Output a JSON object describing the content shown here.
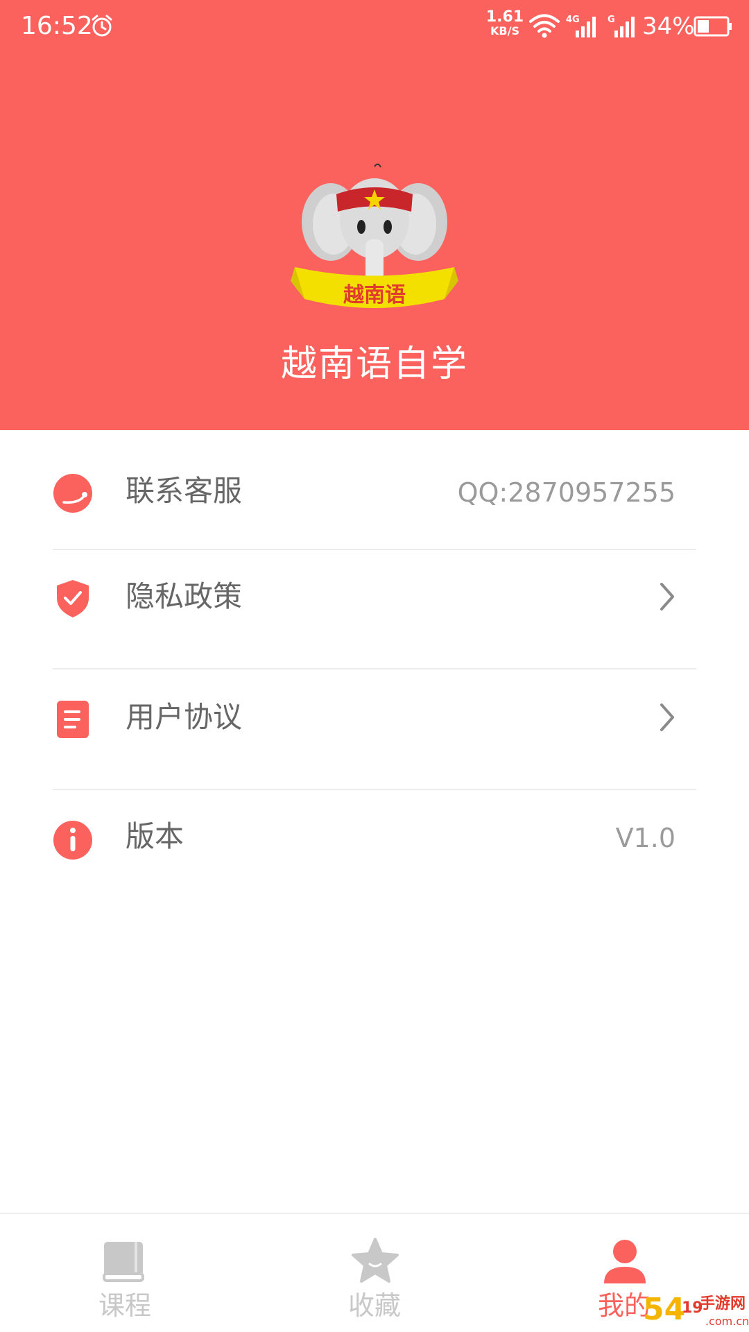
{
  "status_bar": {
    "time": "16:52",
    "net_speed_value": "1.61",
    "net_speed_unit": "KB/S",
    "network_1": "4G",
    "network_2": "G",
    "battery": "34%"
  },
  "header": {
    "logo_text": "越南语",
    "app_title": "越南语自学",
    "color": "#fb625e"
  },
  "menu": {
    "items": [
      {
        "label": "联系客服",
        "value": "QQ:2870957255",
        "icon": "headset-icon"
      },
      {
        "label": "隐私政策",
        "value": "",
        "icon": "shield-check-icon"
      },
      {
        "label": "用户协议",
        "value": "",
        "icon": "document-icon"
      },
      {
        "label": "版本",
        "value": "V1.0",
        "icon": "info-icon"
      }
    ]
  },
  "bottom_nav": {
    "items": [
      {
        "label": "课程",
        "icon": "book-icon",
        "active": false
      },
      {
        "label": "收藏",
        "icon": "star-icon",
        "active": false
      },
      {
        "label": "我的",
        "icon": "user-icon",
        "active": true
      }
    ],
    "active_color": "#fb625e",
    "inactive_color": "#c8c8c8"
  },
  "watermark": {
    "text": "5419手游网",
    "domain": ".com.cn"
  }
}
